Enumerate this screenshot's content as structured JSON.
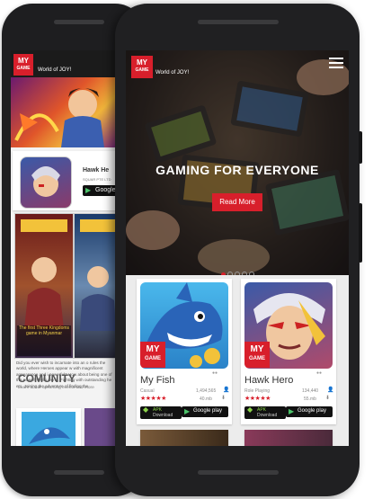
{
  "brand": {
    "logo_line1": "MY",
    "logo_line2": "GAME",
    "tagline": "World of JOY!"
  },
  "hero": {
    "title": "GAMING FOR EVERYONE",
    "button_label": "Read More",
    "slide_count": 5,
    "active_slide": 0
  },
  "games": [
    {
      "title": "My Fish",
      "category": "Casual",
      "downloads": "1,494,565",
      "size": "40.mb",
      "rating": 5,
      "apk_label": "APK",
      "apk_sub": "Download",
      "play_label": "Google play"
    },
    {
      "title": "Hawk Hero",
      "category": "Role Playing",
      "downloads": "134,440",
      "size": "55.mb",
      "rating": 5,
      "apk_label": "APK",
      "apk_sub": "Download",
      "play_label": "Google play"
    }
  ],
  "back_screen": {
    "featured": {
      "title": "Hawk He",
      "developer": "SQUAR PTE LTD",
      "play_label": "Google"
    },
    "banner_caption": "The first Three Kingdoms game in Myanmar",
    "description": "Did you ever wish to incarnate into an o rules the world, where Heroes appear w with magnificent appearance and i powerful? How about being one of the powerf Wulin world. Fighting with outstanding he etc. Joining the adventure of finding the",
    "section_title": "COMUNITY",
    "section_sub": "Learn about upcoming events and more"
  },
  "colors": {
    "brand_red": "#d81f2b",
    "star_red": "#d81f2b",
    "apk_green": "#8bd34a"
  }
}
